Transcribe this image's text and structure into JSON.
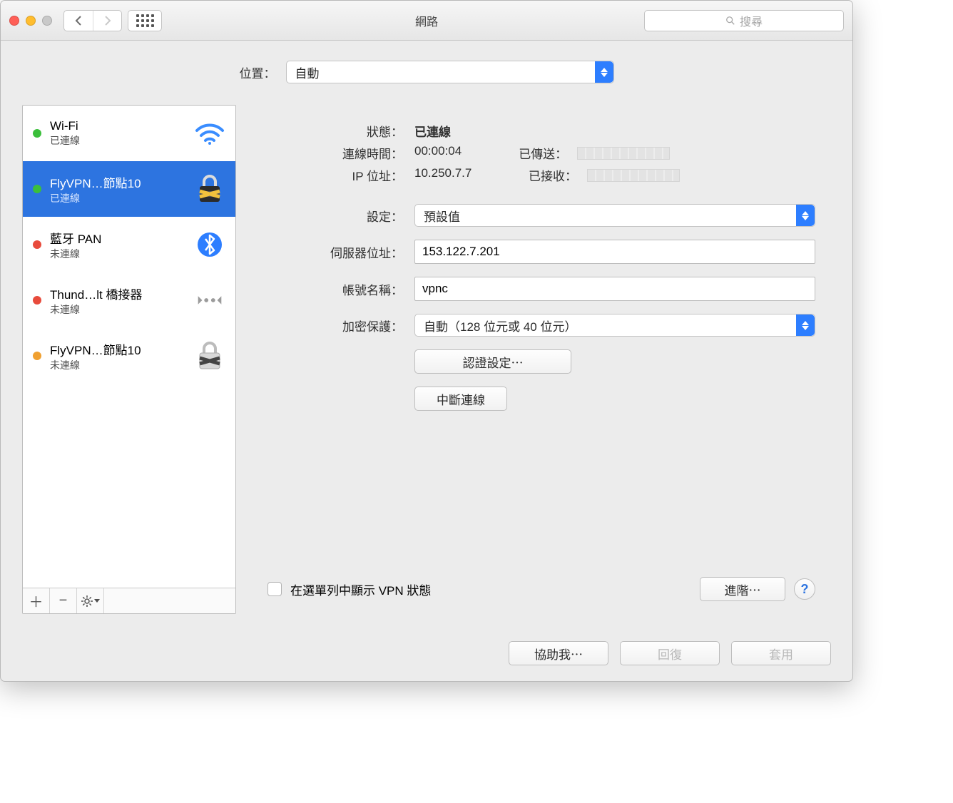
{
  "window": {
    "title": "網路",
    "search_placeholder": "搜尋"
  },
  "location": {
    "label": "位置：",
    "value": "自動"
  },
  "sidebar": {
    "items": [
      {
        "name": "Wi-Fi",
        "status_text": "已連線",
        "status": "green",
        "icon": "wifi"
      },
      {
        "name": "FlyVPN…節點10",
        "status_text": "已連線",
        "status": "green",
        "icon": "lock-dark"
      },
      {
        "name": "藍牙 PAN",
        "status_text": "未連線",
        "status": "red",
        "icon": "bluetooth"
      },
      {
        "name": "Thund…lt 橋接器",
        "status_text": "未連線",
        "status": "red",
        "icon": "thunderbolt"
      },
      {
        "name": "FlyVPN…節點10",
        "status_text": "未連線",
        "status": "orange",
        "icon": "lock-light"
      }
    ]
  },
  "detail": {
    "status_label": "狀態：",
    "status_value": "已連線",
    "connect_time_label": "連線時間：",
    "connect_time_value": "00:00:04",
    "ip_label": "IP 位址：",
    "ip_value": "10.250.7.7",
    "sent_label": "已傳送：",
    "recv_label": "已接收：",
    "config_label": "設定：",
    "config_value": "預設值",
    "server_label": "伺服器位址：",
    "server_value": "153.122.7.201",
    "account_label": "帳號名稱：",
    "account_value": "vpnc",
    "encrypt_label": "加密保護：",
    "encrypt_value": "自動（128 位元或 40 位元）",
    "auth_button": "認證設定⋯",
    "disconnect_button": "中斷連線",
    "show_vpn_label": "在選單列中顯示 VPN 狀態",
    "advanced_button": "進階⋯"
  },
  "footer": {
    "help_me": "協助我⋯",
    "revert": "回復",
    "apply": "套用"
  }
}
